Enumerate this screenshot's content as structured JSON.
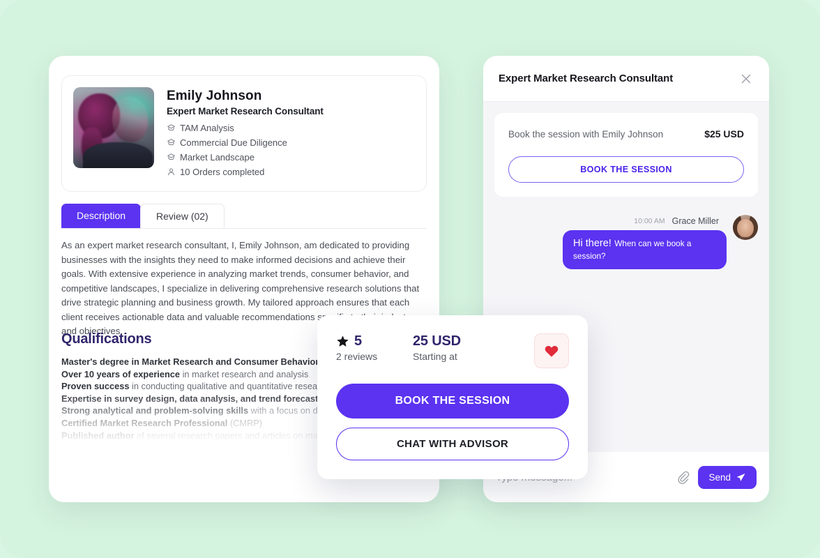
{
  "theme": {
    "background": "#d5f4df",
    "accent_purple": "#5b33f0",
    "deep_indigo": "#31256d",
    "heart_red": "#e02b3a"
  },
  "profile": {
    "name": "Emily Johnson",
    "role": "Expert Market Research Consultant",
    "services": [
      "TAM Analysis",
      "Commercial Due Diligence",
      "Market Landscape"
    ],
    "orders": "10 Orders completed"
  },
  "tabs": [
    {
      "label": "Description",
      "active": true
    },
    {
      "label": "Review (02)",
      "active": false
    }
  ],
  "description": "As an expert market research consultant, I, Emily Johnson, am dedicated to providing businesses with the insights they need to make informed decisions and achieve their goals. With extensive experience in analyzing market trends, consumer behavior, and competitive landscapes, I specialize in delivering comprehensive research solutions that drive strategic planning and business growth. My tailored approach ensures that each client receives actionable data and valuable recommendations specific to their industry and objectives.",
  "qualifications": {
    "title": "Qualifications",
    "items": [
      {
        "bold": "Master's degree in Market Research and Consumer Behavior",
        "rest": ""
      },
      {
        "bold": "Over 10 years of experience",
        "rest": " in market research and analysis"
      },
      {
        "bold": "Proven success",
        "rest": " in conducting qualitative and quantitative research"
      },
      {
        "bold": "Expertise in survey design, data analysis, and trend forecasting",
        "rest": ""
      },
      {
        "bold": "Strong analytical and problem-solving skills",
        "rest": " with a focus on delivering actionable reports"
      },
      {
        "bold": "Certified Market Research Professional",
        "rest": " (CMRP)"
      },
      {
        "bold": "Published author",
        "rest": " of several research papers and articles on market insights"
      }
    ]
  },
  "floating_card": {
    "rating_value": "5",
    "reviews_label": "2 reviews",
    "price": "25 USD",
    "price_sub": "Starting at",
    "favorite_icon": "heart-icon",
    "primary_button": "BOOK THE SESSION",
    "secondary_button": "CHAT WITH ADVISOR"
  },
  "chat": {
    "header_title": "Expert Market Research Consultant",
    "close_icon": "close-icon",
    "booking": {
      "label": "Book the session with Emily Johnson",
      "price": "$25 USD",
      "button": "BOOK THE SESSION"
    },
    "message": {
      "time": "10:00 AM",
      "sender": "Grace Miller",
      "text_lead": "Hi there!",
      "text_rest": "When can we book a session?"
    },
    "input": {
      "placeholder": "Type message...",
      "value": "",
      "attach_icon": "paperclip-icon",
      "send_label": "Send",
      "send_icon": "paper-plane-icon"
    }
  }
}
